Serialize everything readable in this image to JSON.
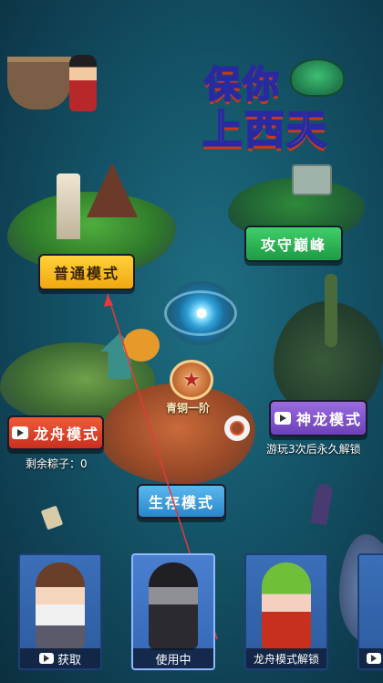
{
  "title": {
    "line1": "保你",
    "line2": "上西天"
  },
  "modes": {
    "normal": "普通模式",
    "attack": "攻守巅峰",
    "dragon": "神龙模式",
    "dragon_boat": "龙舟模式",
    "survival": "生存模式"
  },
  "captions": {
    "zongzi_remaining": "剩余粽子：0",
    "dragon_unlock": "游玩3次后永久解锁"
  },
  "rank": {
    "label": "青铜一阶",
    "icon": "bronze-star-badge-icon"
  },
  "skins": [
    {
      "label": "获取",
      "has_video_icon": true,
      "state": "available"
    },
    {
      "label": "使用中",
      "has_video_icon": false,
      "state": "selected"
    },
    {
      "label": "龙舟模式解锁",
      "has_video_icon": false,
      "state": "locked"
    },
    {
      "label": "",
      "has_video_icon": true,
      "state": "partial"
    }
  ],
  "colors": {
    "ocean": "#15566a",
    "normal_btn": "#ffd23a",
    "attack_btn": "#3fcf6a",
    "dragon_btn": "#9a6ce0",
    "dragon_boat_btn": "#f05a3a",
    "survival_btn": "#5ab8f0",
    "card": "#3b6fb8"
  }
}
